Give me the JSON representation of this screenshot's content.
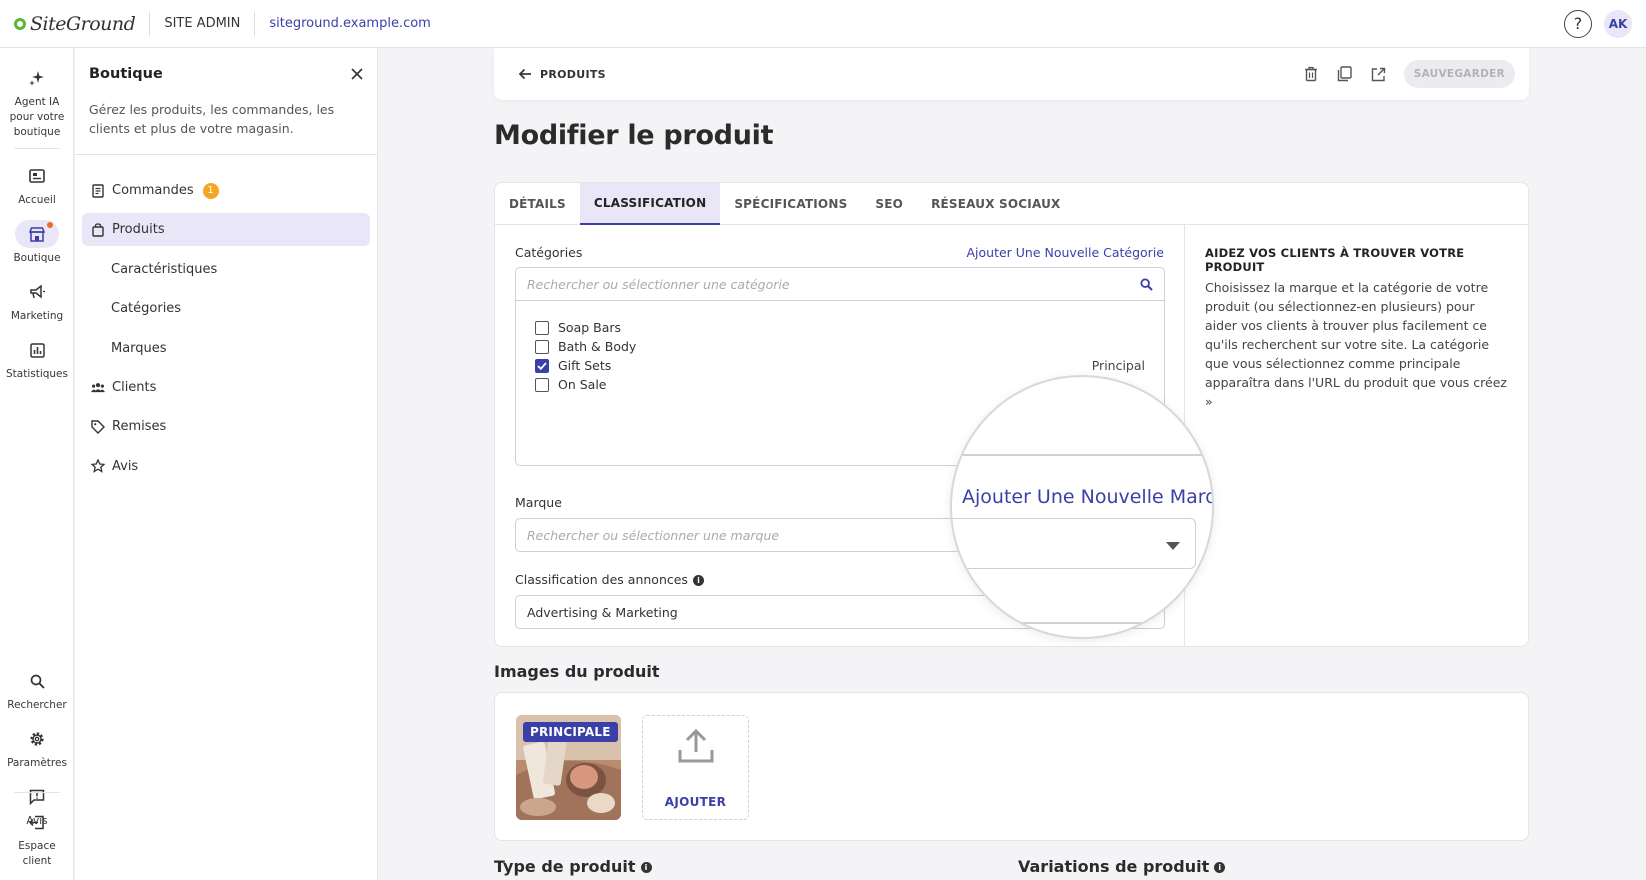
{
  "header": {
    "logo_text": "SiteGround",
    "section": "SITE ADMIN",
    "site_url": "siteground.example.com",
    "help_label": "?",
    "avatar_initials": "AK"
  },
  "rail": {
    "ai_agent": "Agent IA pour votre boutique",
    "home": "Accueil",
    "shop": "Boutique",
    "marketing": "Marketing",
    "stats": "Statistiques",
    "search": "Rechercher",
    "settings": "Paramètres",
    "feedback": "Avis",
    "client_area": "Espace client"
  },
  "panel": {
    "title": "Boutique",
    "description": "Gérez les produits, les commandes, les clients et plus de votre magasin.",
    "nav": {
      "orders": "Commandes",
      "orders_badge": "1",
      "products": "Produits",
      "features": "Caractéristiques",
      "categories": "Catégories",
      "brands": "Marques",
      "customers": "Clients",
      "discounts": "Remises",
      "reviews": "Avis"
    }
  },
  "toolbar": {
    "back_label": "PRODUITS",
    "save_label": "SAUVEGARDER"
  },
  "page": {
    "title": "Modifier le produit"
  },
  "tabs": {
    "details": "DÉTAILS",
    "classification": "CLASSIFICATION",
    "specs": "SPÉCIFICATIONS",
    "seo": "SEO",
    "social": "RÉSEAUX SOCIAUX"
  },
  "form": {
    "categories_label": "Catégories",
    "add_category_link": "Ajouter Une Nouvelle Catégorie",
    "category_search_placeholder": "Rechercher ou sélectionner une catégorie",
    "categories": [
      {
        "name": "Soap Bars",
        "checked": false
      },
      {
        "name": "Bath & Body",
        "checked": false
      },
      {
        "name": "Gift Sets",
        "checked": true
      },
      {
        "name": "On Sale",
        "checked": false
      }
    ],
    "primary_label": "Principal",
    "brand_label": "Marque",
    "brand_placeholder": "Rechercher ou sélectionner une marque",
    "listing_label": "Classification des annonces",
    "listing_value": "Advertising & Marketing"
  },
  "magnifier": {
    "add_brand_link": "Ajouter Une Nouvelle Marque"
  },
  "help": {
    "title": "AIDEZ VOS CLIENTS À TROUVER VOTRE PRODUIT",
    "text": "Choisissez la marque et la catégorie de votre produit (ou sélectionnez-en plusieurs) pour aider vos clients à trouver plus facilement ce qu'ils recherchent sur votre site. La catégorie que vous sélectionnez comme principale apparaîtra dans l'URL du produit que vous créez »"
  },
  "images": {
    "title": "Images du produit",
    "primary_badge": "PRINCIPALE",
    "add_label": "AJOUTER"
  },
  "bottom": {
    "product_type": "Type de produit",
    "variations": "Variations de produit"
  },
  "colors": {
    "accent": "#3b3fa8",
    "accent_light": "#e8e6f7",
    "badge": "#f5a623",
    "notification_dot": "#f26b1d",
    "logo_green": "#5db534"
  }
}
